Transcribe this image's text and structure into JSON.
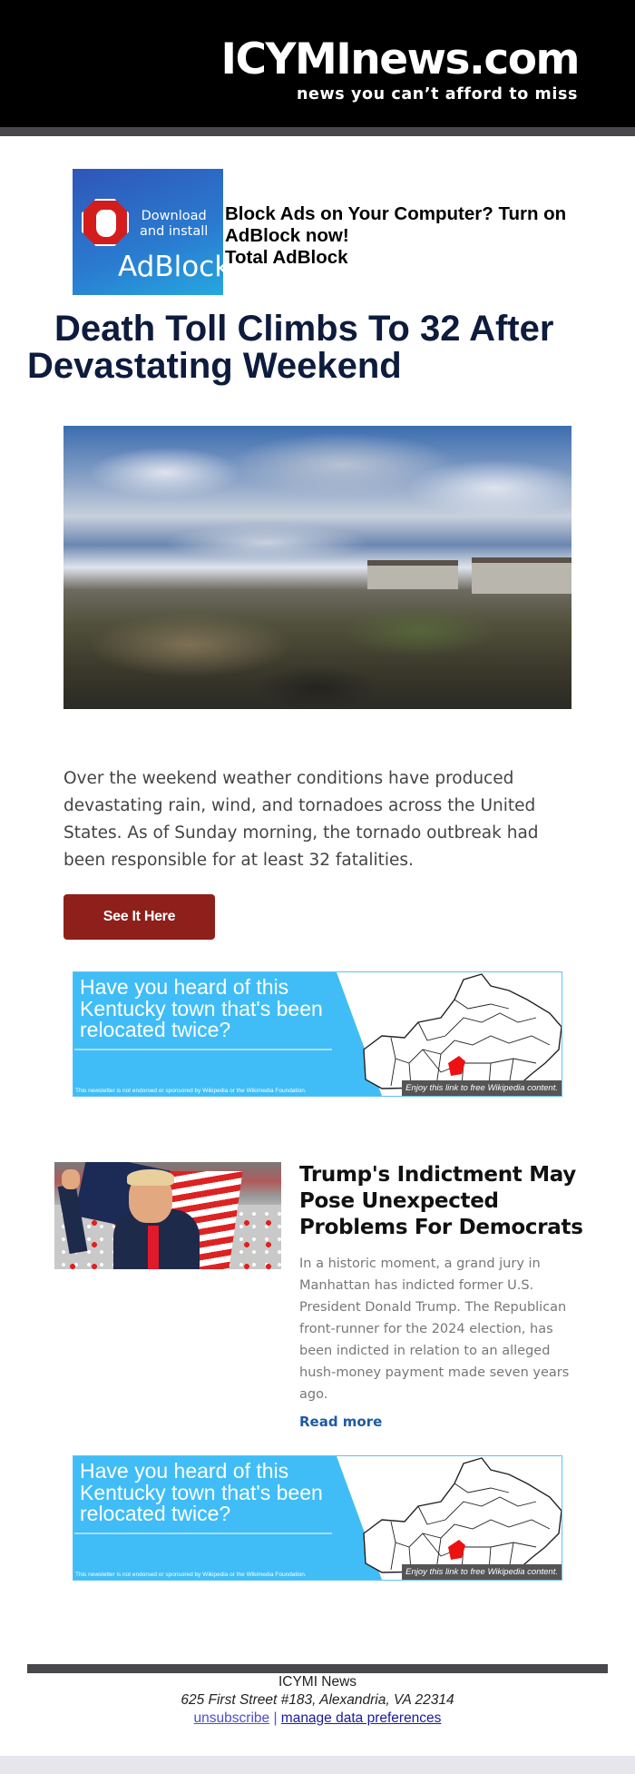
{
  "header": {
    "logo": "ICYMInews.com",
    "tagline": "news you can’t afford to miss"
  },
  "top_ad": {
    "image": {
      "line1": "Download",
      "line2": "and install",
      "brand": "AdBlock",
      "icon": "stop-hand-icon"
    },
    "headline": "Block Ads on Your Computer? Turn on AdBlock now!",
    "sponsor": "Total AdBlock"
  },
  "article1": {
    "title": "Death Toll Climbs To 32 After Devastating Weekend",
    "image_alt": "Tornado debris field with destroyed houses under cloudy sky",
    "body": "Over the weekend weather conditions have produced devastating rain, wind, and tornadoes across the United States. As of Sunday morning, the tornado outbreak had been responsible for at least 32 fatalities.",
    "cta_label": "See It Here",
    "cta_color": "#8e1f1a"
  },
  "wiki_banners": [
    {
      "question": "Have you heard of this Kentucky town that's been relocated twice?",
      "disclaimer": "This newsletter is not endorsed or sponsored by Wikipedia or the Wikimedia Foundation.",
      "tag": "Enjoy this link to free Wikipedia content.",
      "accent": "#40bdf7"
    },
    {
      "question": "Have you heard of this Kentucky town that's been relocated twice?",
      "disclaimer": "This newsletter is not endorsed or sponsored by Wikipedia or the Wikimedia Foundation.",
      "tag": "Enjoy this link to free Wikipedia content.",
      "accent": "#40bdf7"
    }
  ],
  "article2": {
    "title": "Trump's Indictment May Pose Unexpected Problems For Democrats",
    "image_alt": "Donald Trump raising fist in front of rally crowd and flags",
    "body": "In a historic moment, a grand jury in Manhattan has indicted former U.S. President Donald Trump. The Republican front-runner for the 2024 election, has been indicted in relation to an alleged hush-money payment made seven years ago.",
    "read_more": "Read more",
    "link_color": "#1e5aa3"
  },
  "footer": {
    "company": "ICYMI News",
    "address": "625 First Street #183, Alexandria, VA 22314",
    "unsubscribe": "unsubscribe",
    "separator": "|",
    "manage_prefs": "manage data preferences"
  }
}
